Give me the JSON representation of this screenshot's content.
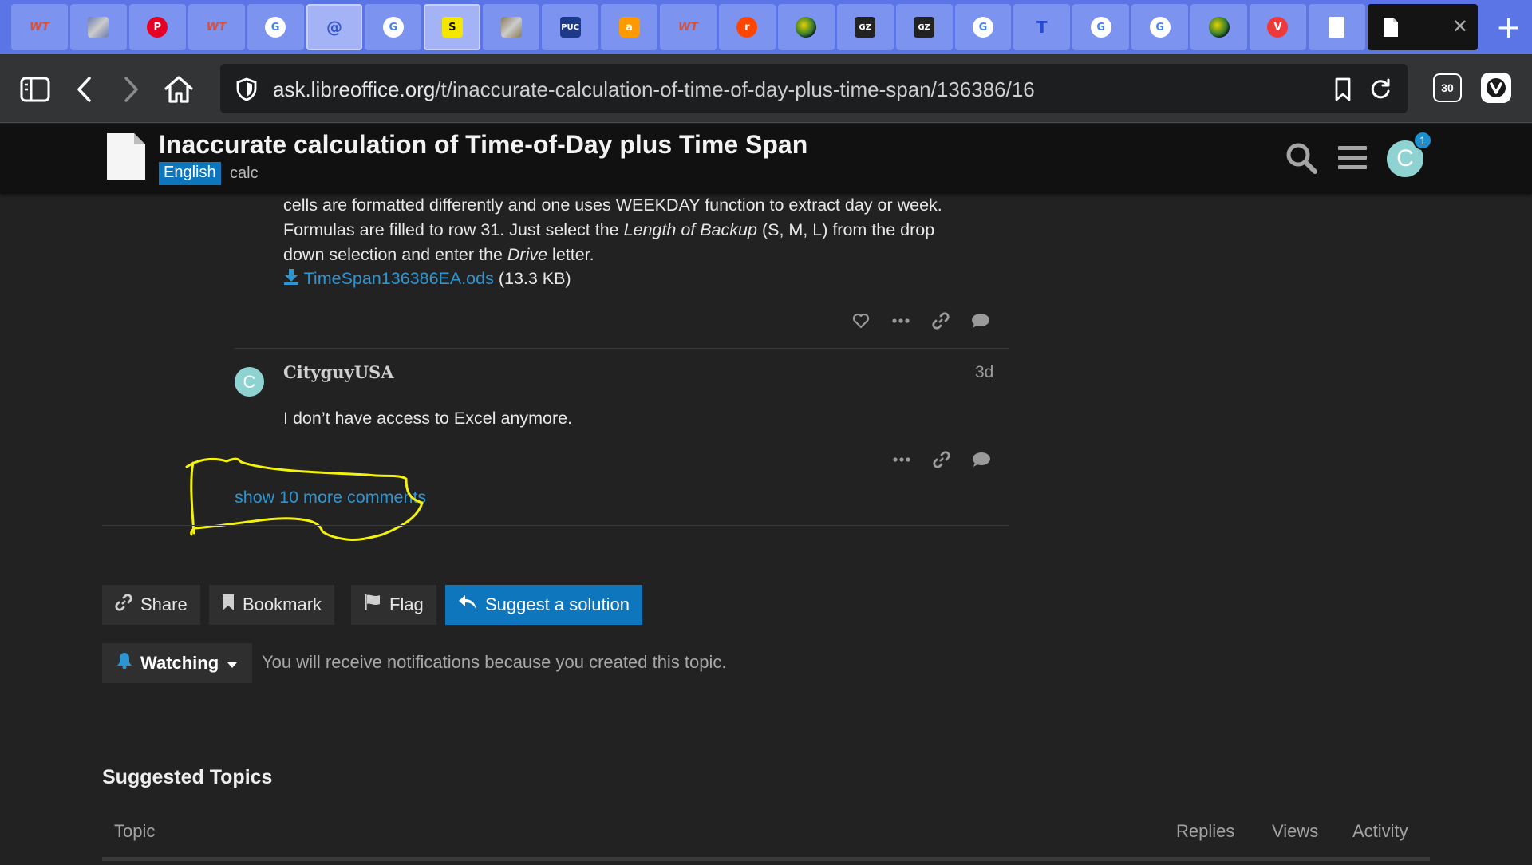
{
  "browser": {
    "tabs": [
      {
        "icon": "wt-icon",
        "glyph": "WT",
        "bg": "#7d93f0",
        "color": "#d8513a"
      },
      {
        "icon": "painting-icon",
        "glyph": "",
        "bg": "#7d93f0",
        "color": "#6a7bb0"
      },
      {
        "icon": "pinterest-icon",
        "glyph": "P",
        "bg": "#7d93f0",
        "color": "#e60023"
      },
      {
        "icon": "wt-icon",
        "glyph": "WT",
        "bg": "#7d93f0",
        "color": "#d8513a"
      },
      {
        "icon": "google-icon",
        "glyph": "G",
        "bg": "#7d93f0",
        "color": "#4285f4"
      },
      {
        "icon": "elephant-icon",
        "glyph": "@",
        "bg": "#a4b3f5",
        "color": "#3558c8"
      },
      {
        "icon": "google-icon",
        "glyph": "G",
        "bg": "#7d93f0",
        "color": "#4285f4"
      },
      {
        "icon": "s-icon",
        "glyph": "S",
        "bg": "#a4b3f5",
        "color": "#111111"
      },
      {
        "icon": "painting-icon",
        "glyph": "",
        "bg": "#7d93f0",
        "color": "#8a7a55"
      },
      {
        "icon": "puc-icon",
        "glyph": "PUC",
        "bg": "#7d93f0",
        "color": "#ffffff"
      },
      {
        "icon": "amazon-icon",
        "glyph": "a",
        "bg": "#7d93f0",
        "color": "#ffffff"
      },
      {
        "icon": "wt-icon",
        "glyph": "WT",
        "bg": "#7d93f0",
        "color": "#d8513a"
      },
      {
        "icon": "reddit-icon",
        "glyph": "r",
        "bg": "#7d93f0",
        "color": "#ff4500"
      },
      {
        "icon": "globe-icon",
        "glyph": "",
        "bg": "#7d93f0",
        "color": "#2f7a2f"
      },
      {
        "icon": "gz-icon",
        "glyph": "GZ",
        "bg": "#7d93f0",
        "color": "#ffffff"
      },
      {
        "icon": "gz-icon",
        "glyph": "GZ",
        "bg": "#7d93f0",
        "color": "#ffffff"
      },
      {
        "icon": "google-icon",
        "glyph": "G",
        "bg": "#7d93f0",
        "color": "#4285f4"
      },
      {
        "icon": "t-icon",
        "glyph": "T",
        "bg": "#7d93f0",
        "color": "#2a4bd1"
      },
      {
        "icon": "google-icon",
        "glyph": "G",
        "bg": "#7d93f0",
        "color": "#4285f4"
      },
      {
        "icon": "google-icon",
        "glyph": "G",
        "bg": "#7d93f0",
        "color": "#4285f4"
      },
      {
        "icon": "globe-icon",
        "glyph": "",
        "bg": "#7d93f0",
        "color": "#2f7a2f"
      },
      {
        "icon": "vivaldi-icon",
        "glyph": "V",
        "bg": "#7d93f0",
        "color": "#ef3939"
      },
      {
        "icon": "document-icon",
        "glyph": "",
        "bg": "#7d93f0",
        "color": "#ffffff"
      }
    ],
    "active_tab_icon": "document-icon",
    "url_host": "ask.libreoffice.org",
    "url_path": "/t/inaccurate-calculation-of-time-of-day-plus-time-span/136386/16",
    "tab_count": "30"
  },
  "header": {
    "title": "Inaccurate calculation of Time-of-Day plus Time Span",
    "category": "English",
    "tag": "calc",
    "avatar_letter": "C",
    "notification_count": "1"
  },
  "post": {
    "line1": "cells are formatted differently and one uses WEEKDAY function to extract day or week.",
    "line2_a": "Formulas are filled to row 31. Just select the ",
    "line2_em": "Length of Backup",
    "line2_b": " (S, M, L) from the drop",
    "line3_a": "down selection and enter the ",
    "line3_em": "Drive",
    "line3_b": " letter.",
    "attachment_name": "TimeSpan136386EA.ods",
    "attachment_size": " (13.3 KB)"
  },
  "comment": {
    "avatar_letter": "C",
    "username": "CityguyUSA",
    "date": "3d",
    "text": "I don’t have access to Excel anymore."
  },
  "show_more": "show 10 more comments",
  "buttons": {
    "share": "Share",
    "bookmark": "Bookmark",
    "flag": "Flag",
    "suggest": "Suggest a solution"
  },
  "notifications": {
    "level": "Watching",
    "reason": "You will receive notifications because you created this topic."
  },
  "suggested": {
    "heading": "Suggested Topics",
    "columns": [
      "Topic",
      "Replies",
      "Views",
      "Activity"
    ]
  },
  "colors": {
    "accent": "#0e76bd",
    "link": "#2e95d3",
    "annotation": "#f2f20a",
    "tab_strip": "#5b74e6"
  }
}
